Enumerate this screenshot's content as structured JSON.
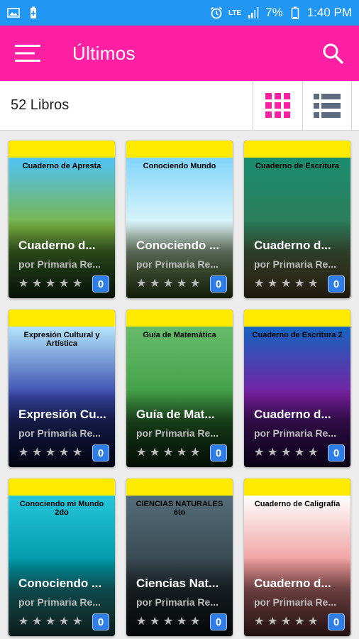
{
  "status_bar": {
    "left_icons": [
      "image-icon",
      "battery-saver-icon"
    ],
    "alarm_icon": "alarm-icon",
    "network": "LTE",
    "signal_icon": "signal-icon",
    "battery_percent": "7%",
    "battery_icon": "battery-icon",
    "time": "1:40 PM"
  },
  "app_bar": {
    "title": "Últimos",
    "menu_icon": "hamburger-menu-icon",
    "search_icon": "search-icon"
  },
  "toolbar": {
    "count_label": "52 Libros",
    "grid_view_icon": "grid-view-icon",
    "list_view_icon": "list-view-icon"
  },
  "colors": {
    "status_bar": "#2196f3",
    "app_bar": "#ff1fa2",
    "active_view": "#ff1fa2",
    "inactive_view": "#5c6b80",
    "card_top": "#ffea00",
    "badge": "#2f7ee8"
  },
  "books": [
    {
      "title": "Cuaderno de Apresta...",
      "author": "por Primaria Regular",
      "rating": 0,
      "downloads": "0",
      "cover_text": "Cuaderno de Apresta",
      "cover_colors": [
        "#4fc3f7",
        "#7cb342",
        "#2e7d32"
      ]
    },
    {
      "title": "Conociendo mi Mundo",
      "author": "por Primaria Regular",
      "rating": 0,
      "downloads": "0",
      "cover_text": "Conociendo Mundo",
      "cover_colors": [
        "#81d4fa",
        "#e0f7fa",
        "#8bc34a"
      ]
    },
    {
      "title": "Cuaderno de Escritura",
      "author": "por Primaria Regular",
      "rating": 0,
      "downloads": "0",
      "cover_text": "Cuaderno de Escritura",
      "cover_colors": [
        "#1a8c6e",
        "#2e7d5a",
        "#c4a15a"
      ]
    },
    {
      "title": "Expresión Cultural",
      "author": "por Primaria Regular",
      "rating": 0,
      "downloads": "0",
      "cover_text": "Expresión Cultural y Artística",
      "cover_colors": [
        "#b3e5fc",
        "#3949ab",
        "#1a237e"
      ]
    },
    {
      "title": "Guía de Matemática",
      "author": "por Primaria Regular",
      "rating": 0,
      "downloads": "0",
      "cover_text": "Guía de Matemática",
      "cover_colors": [
        "#66bb6a",
        "#43a047",
        "#1b5e20"
      ]
    },
    {
      "title": "Cuaderno de Escritura 2",
      "author": "por Primaria Regular",
      "rating": 0,
      "downloads": "0",
      "cover_text": "Cuaderno de Escritura 2",
      "cover_colors": [
        "#1565c0",
        "#7b1fa2",
        "#4a148c"
      ]
    },
    {
      "title": "Conociendo mi Mundo 2do",
      "author": "por Primaria Regular",
      "rating": 0,
      "downloads": "0",
      "cover_text": "Conociendo mi Mundo 2do",
      "cover_colors": [
        "#26c6da",
        "#0097a7",
        "#4db6ac"
      ]
    },
    {
      "title": "Ciencias Naturales",
      "author": "por Primaria Regular",
      "rating": 0,
      "downloads": "0",
      "cover_text": "CIENCIAS NATURALES 6to",
      "cover_colors": [
        "#546e7a",
        "#37474f",
        "#263238"
      ]
    },
    {
      "title": "Cuaderno de Caligrafía",
      "author": "por Primaria Regular",
      "rating": 0,
      "downloads": "0",
      "cover_text": "Cuaderno de Caligrafía",
      "cover_colors": [
        "#ffffff",
        "#ef9a9a",
        "#e57373"
      ]
    }
  ],
  "card_labels": [
    {
      "title": "Cuaderno d...",
      "author": "por Primaria Re..."
    },
    {
      "title": "Conociendo ...",
      "author": "por Primaria Re..."
    },
    {
      "title": "Cuaderno d...",
      "author": "por Primaria Re..."
    },
    {
      "title": "Expresión Cu...",
      "author": "por Primaria Re..."
    },
    {
      "title": "Guía de Mat...",
      "author": "por Primaria Re..."
    },
    {
      "title": "Cuaderno d...",
      "author": "por Primaria Re..."
    },
    {
      "title": "Conociendo ...",
      "author": "por Primaria Re..."
    },
    {
      "title": "Ciencias Nat...",
      "author": "por Primaria Re..."
    },
    {
      "title": "Cuaderno d...",
      "author": "por Primaria Re..."
    }
  ]
}
